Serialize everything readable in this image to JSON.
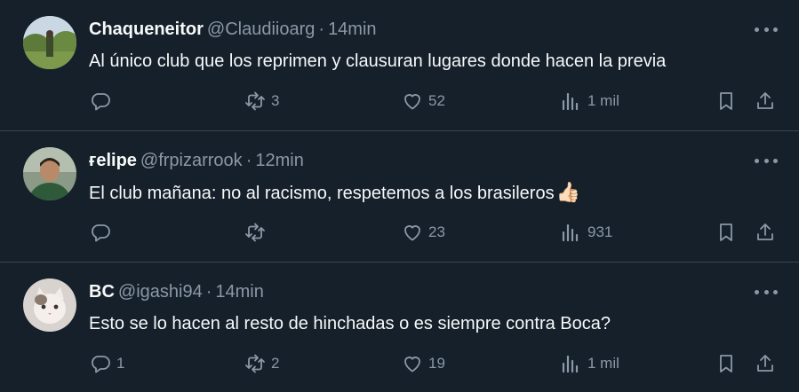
{
  "tweets": [
    {
      "name": "Chaqueneitor",
      "handle": "@Claudiioarg",
      "time": "14min",
      "text": "Al único club que los reprimen y clausuran lugares donde hacen la previa",
      "emoji": "",
      "replies": "",
      "retweets": "3",
      "likes": "52",
      "views": "1 mil",
      "avatar_icon": "landscape-photo-avatar"
    },
    {
      "name": "ғelipe",
      "handle": "@frpizarrook",
      "time": "12min",
      "text": "El club mañana: no al racismo, respetemos a los brasileros",
      "emoji": "👍🏻",
      "replies": "",
      "retweets": "",
      "likes": "23",
      "views": "931",
      "avatar_icon": "person-photo-avatar"
    },
    {
      "name": "BC",
      "handle": "@igashi94",
      "time": "14min",
      "text": "Esto se lo hacen al resto de hinchadas o es siempre contra Boca?",
      "emoji": "",
      "replies": "1",
      "retweets": "2",
      "likes": "19",
      "views": "1 mil",
      "avatar_icon": "cat-photo-avatar"
    }
  ],
  "separator": "·",
  "colors": {
    "background": "#15202b",
    "text": "#f7f9f9",
    "secondary": "#8b98a5",
    "divider": "#38444d"
  }
}
